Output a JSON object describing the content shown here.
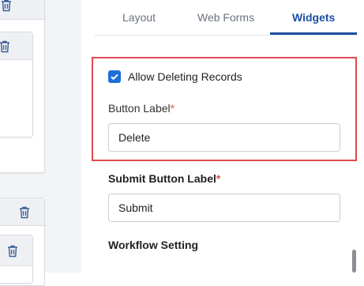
{
  "tabs": [
    {
      "label": "Layout"
    },
    {
      "label": "Web Forms"
    },
    {
      "label": "Widgets"
    }
  ],
  "active_tab": "Widgets",
  "allow_delete": {
    "checked": true,
    "label": "Allow Deleting Records"
  },
  "button_label": {
    "label": "Button Label",
    "required_mark": "*",
    "value": "Delete"
  },
  "submit_button_label": {
    "label": "Submit Button Label",
    "required_mark": "*",
    "value": "Submit"
  },
  "workflow_section": {
    "title": "Workflow Setting"
  },
  "colors": {
    "accent": "#1d4ea3",
    "checkbox": "#1d6fd8",
    "highlight_border": "#e0494f",
    "required": "#d9534f"
  },
  "icons": [
    "trash-icon",
    "check-icon"
  ]
}
